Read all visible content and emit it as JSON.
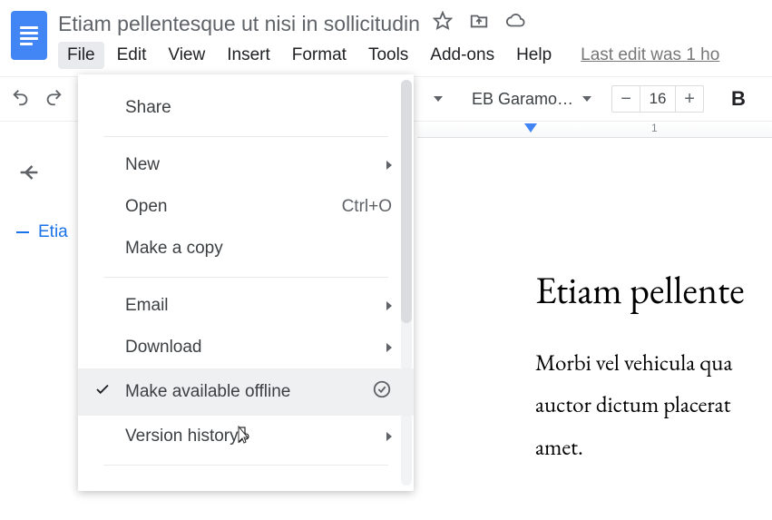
{
  "doc": {
    "title": "Etiam pellentesque ut nisi in sollicitudin"
  },
  "menubar": {
    "items": [
      "File",
      "Edit",
      "View",
      "Insert",
      "Format",
      "Tools",
      "Add-ons",
      "Help"
    ],
    "last_edit": "Last edit was 1 ho"
  },
  "toolbar": {
    "font_name": "EB Garamo…",
    "font_size": "16",
    "minus": "−",
    "plus": "+",
    "bold": "B"
  },
  "ruler": {
    "label1": "1"
  },
  "outline": {
    "item": "Etia"
  },
  "page": {
    "title": "Etiam pellente",
    "body1": "Morbi vel vehicula qua",
    "body2": "auctor dictum placerat",
    "body3": "amet."
  },
  "menu": {
    "share": "Share",
    "new": "New",
    "open": "Open",
    "open_shortcut": "Ctrl+O",
    "make_copy": "Make a copy",
    "email": "Email",
    "download": "Download",
    "make_offline": "Make available offline",
    "version_history": "Version history"
  }
}
